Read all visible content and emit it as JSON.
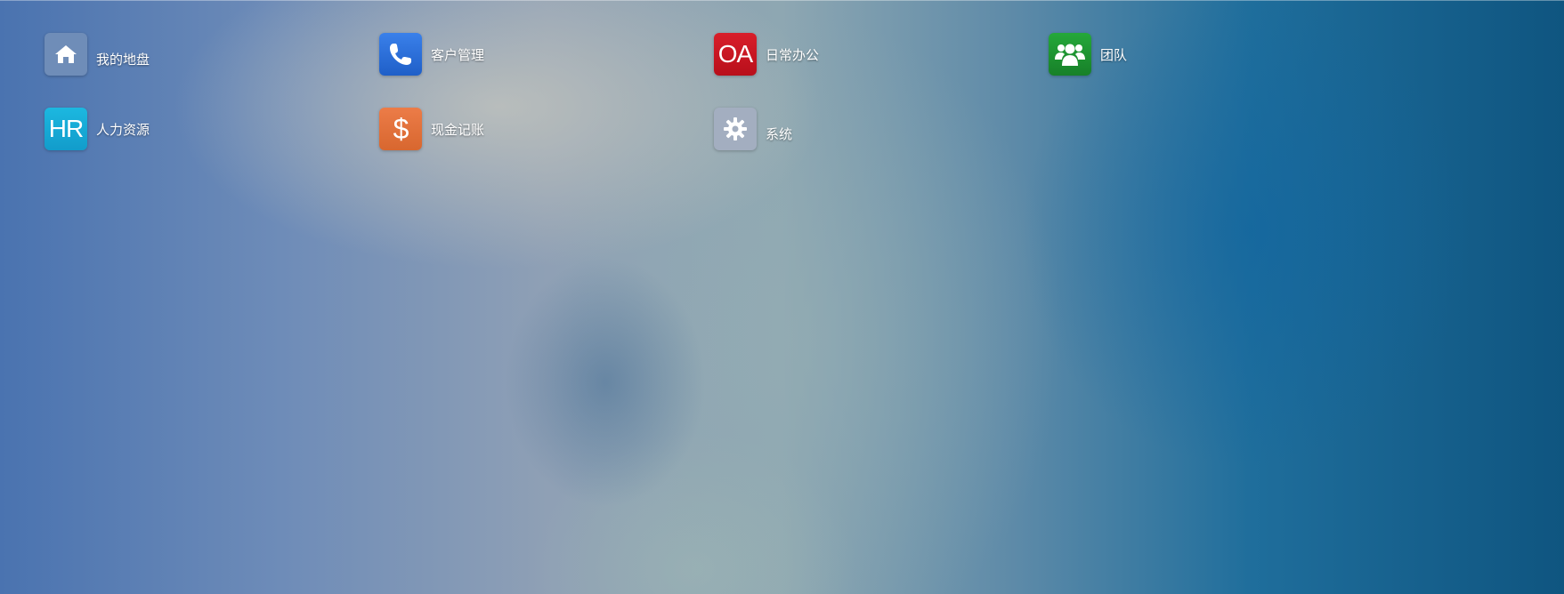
{
  "apps": [
    {
      "label": "我的地盘",
      "icon": "home-icon",
      "color": "#6f8db8"
    },
    {
      "label": "客户管理",
      "icon": "phone-icon",
      "color": "#2a6bd6"
    },
    {
      "label": "日常办公",
      "icon": "oa-icon",
      "icon_text": "OA",
      "color": "#c91622"
    },
    {
      "label": "团队",
      "icon": "team-icon",
      "color": "#1e9430"
    },
    {
      "label": "人力资源",
      "icon": "hr-icon",
      "icon_text": "HR",
      "color": "#17a9d6"
    },
    {
      "label": "现金记账",
      "icon": "dollar-icon",
      "icon_text": "$",
      "color": "#e37240"
    },
    {
      "label": "系统",
      "icon": "gear-icon",
      "color": "#a3aec0"
    }
  ]
}
